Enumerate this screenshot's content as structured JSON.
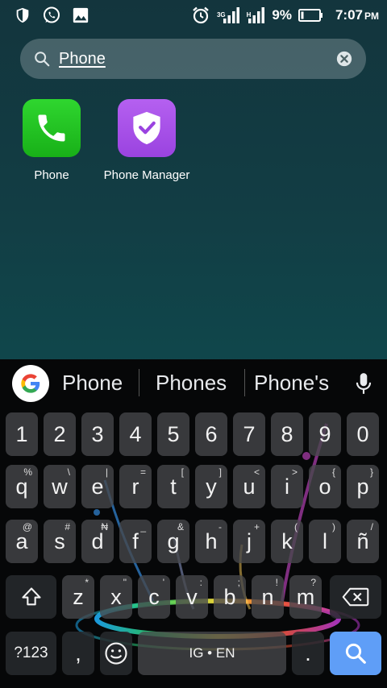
{
  "status_bar": {
    "battery_percent": "9%",
    "time": "7:07",
    "ampm": "PM",
    "net1": "3G",
    "net2": "H"
  },
  "search": {
    "query": "Phone"
  },
  "apps": [
    {
      "label": "Phone",
      "color": "#22c222"
    },
    {
      "label": "Phone Manager",
      "color": "#a64fe8"
    }
  ],
  "keyboard": {
    "suggestions": [
      "Phone",
      "Phones",
      "Phone's"
    ],
    "number_row": [
      "1",
      "2",
      "3",
      "4",
      "5",
      "6",
      "7",
      "8",
      "9",
      "0"
    ],
    "row1": [
      {
        "k": "q",
        "s": "%"
      },
      {
        "k": "w",
        "s": "\\"
      },
      {
        "k": "e",
        "s": "|"
      },
      {
        "k": "r",
        "s": "="
      },
      {
        "k": "t",
        "s": "["
      },
      {
        "k": "y",
        "s": "]"
      },
      {
        "k": "u",
        "s": "<"
      },
      {
        "k": "i",
        "s": ">"
      },
      {
        "k": "o",
        "s": "{"
      },
      {
        "k": "p",
        "s": "}"
      }
    ],
    "row2": [
      {
        "k": "a",
        "s": "@"
      },
      {
        "k": "s",
        "s": "#"
      },
      {
        "k": "d",
        "s": "₦"
      },
      {
        "k": "f",
        "s": "_"
      },
      {
        "k": "g",
        "s": "&"
      },
      {
        "k": "h",
        "s": "-"
      },
      {
        "k": "j",
        "s": "+"
      },
      {
        "k": "k",
        "s": "("
      },
      {
        "k": "l",
        "s": ")"
      },
      {
        "k": "ñ",
        "s": "/"
      }
    ],
    "row3": [
      {
        "k": "z",
        "s": "*"
      },
      {
        "k": "x",
        "s": "\""
      },
      {
        "k": "c",
        "s": "'"
      },
      {
        "k": "v",
        "s": ":"
      },
      {
        "k": "b",
        "s": ";"
      },
      {
        "k": "n",
        "s": "!"
      },
      {
        "k": "m",
        "s": "?"
      }
    ],
    "symbols_label": "?123",
    "comma": ",",
    "space_label": "IG • EN",
    "period": ".",
    "accent_color": "#5f9ef7"
  }
}
